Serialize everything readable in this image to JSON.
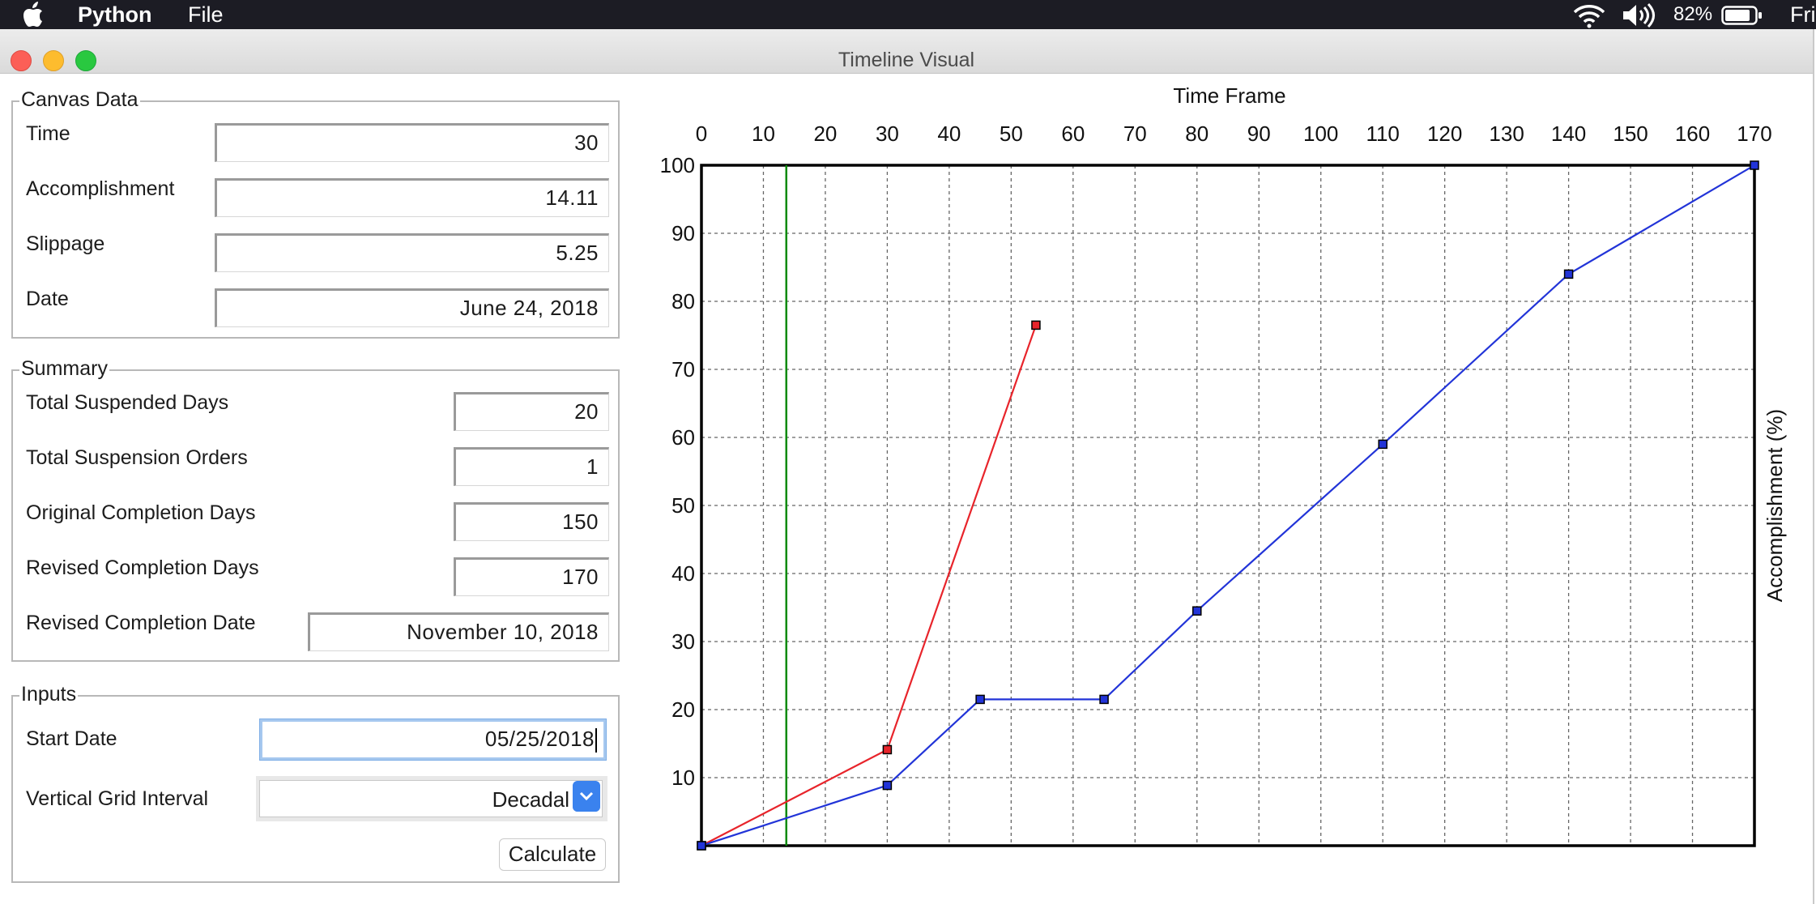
{
  "menubar": {
    "app_name": "Python",
    "menus": [
      "File"
    ],
    "battery_percent": "82%",
    "clock": "Fri"
  },
  "window": {
    "title": "Timeline Visual"
  },
  "canvas_data": {
    "title": "Canvas Data",
    "time_label": "Time",
    "time_value": "30",
    "accomplishment_label": "Accomplishment",
    "accomplishment_value": "14.11",
    "slippage_label": "Slippage",
    "slippage_value": "5.25",
    "date_label": "Date",
    "date_value": "June 24, 2018"
  },
  "summary": {
    "title": "Summary",
    "total_suspended_days_label": "Total Suspended Days",
    "total_suspended_days_value": "20",
    "total_suspension_orders_label": "Total Suspension Orders",
    "total_suspension_orders_value": "1",
    "original_completion_days_label": "Original Completion Days",
    "original_completion_days_value": "150",
    "revised_completion_days_label": "Revised Completion Days",
    "revised_completion_days_value": "170",
    "revised_completion_date_label": "Revised Completion Date",
    "revised_completion_date_value": "November 10, 2018"
  },
  "inputs": {
    "title": "Inputs",
    "start_date_label": "Start Date",
    "start_date_value": "05/25/2018",
    "vertical_grid_interval_label": "Vertical Grid Interval",
    "vertical_grid_interval_value": "Decadal",
    "calculate_label": "Calculate"
  },
  "chart_data": {
    "type": "line",
    "xlabel": "Time Frame",
    "ylabel": "Accomplishment (%)",
    "xlim": [
      0,
      170
    ],
    "ylim": [
      0,
      100
    ],
    "x_ticks": [
      0,
      10,
      20,
      30,
      40,
      50,
      60,
      70,
      80,
      90,
      100,
      110,
      120,
      130,
      140,
      150,
      160,
      170
    ],
    "y_ticks": [
      10,
      20,
      30,
      40,
      50,
      60,
      70,
      80,
      90,
      100
    ],
    "grid": true,
    "marker_line_x": 13.7,
    "series": [
      {
        "color": "#e8242b",
        "x": [
          0,
          30,
          54
        ],
        "y": [
          0,
          14.11,
          76.5
        ]
      },
      {
        "color": "#2234d8",
        "x": [
          0,
          30,
          45,
          65,
          80,
          110,
          140,
          170
        ],
        "y": [
          0,
          8.86,
          21.5,
          21.5,
          34.5,
          59,
          84,
          100
        ]
      }
    ],
    "marker_line_color": "#0a8a0a"
  }
}
